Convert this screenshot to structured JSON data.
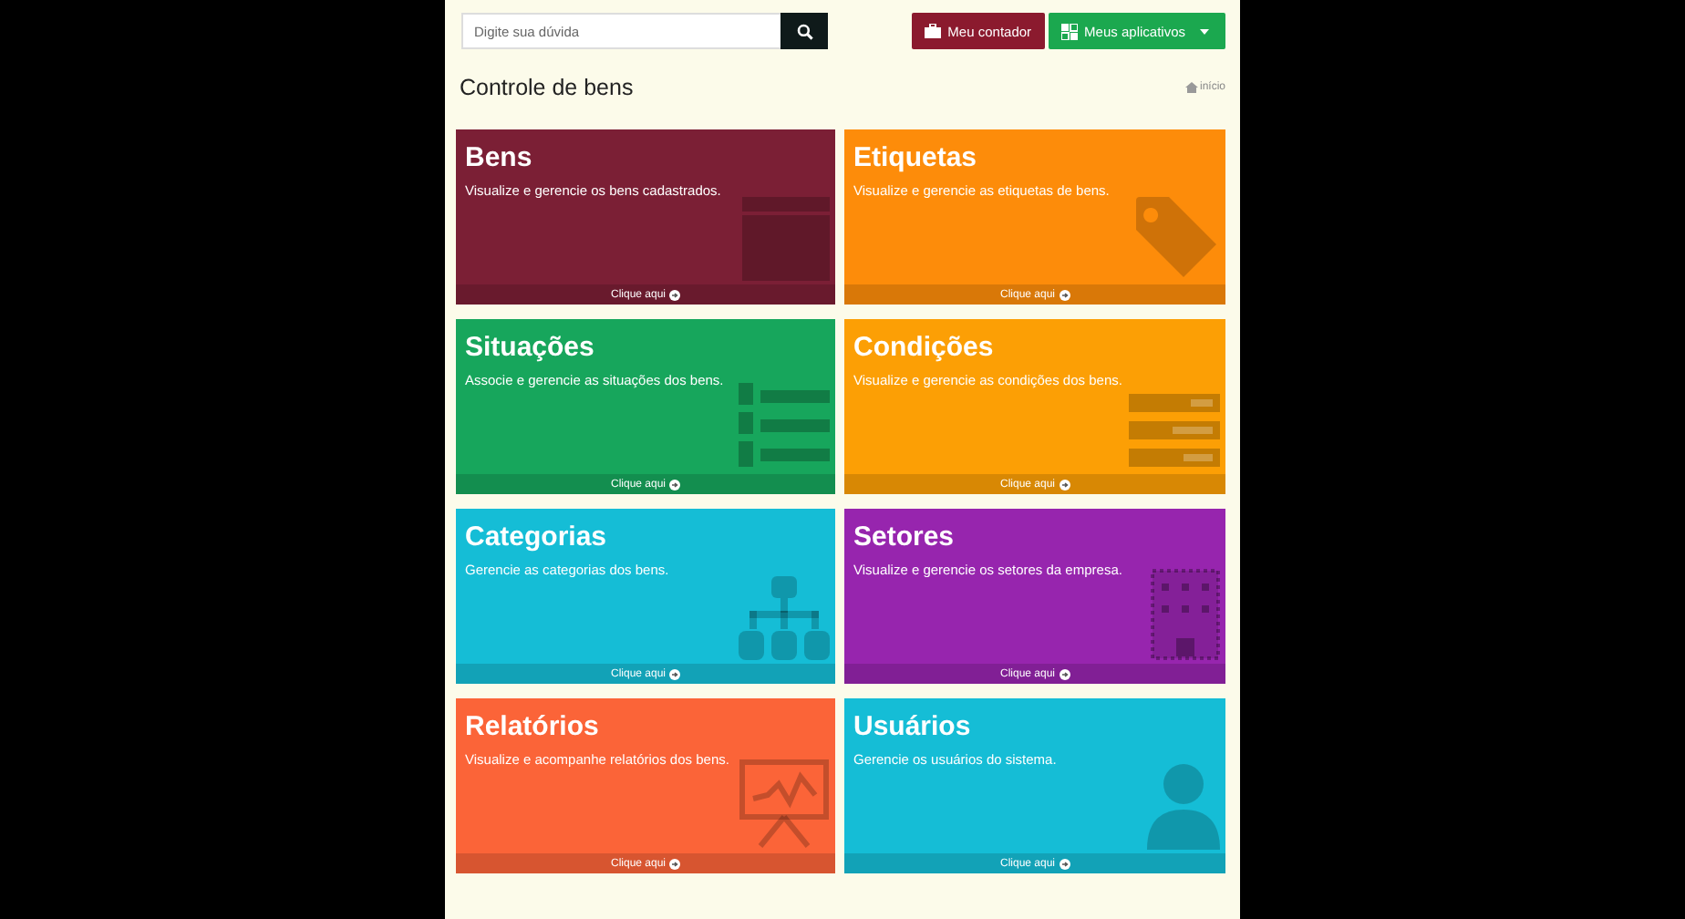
{
  "search": {
    "placeholder": "Digite sua dúvida"
  },
  "header_buttons": [
    {
      "label": "Meu contador",
      "color": "#8b1a2e",
      "kind": "briefcase"
    },
    {
      "label": "Meus aplicativos",
      "color": "#1ba84f",
      "kind": "apps"
    }
  ],
  "page_title": "Controle de bens",
  "breadcrumb": "início",
  "cards": [
    {
      "title": "Bens",
      "description": "Visualize e gerencie os bens cadastrados.",
      "link": "Clique aqui",
      "color": "#7b1f35"
    },
    {
      "title": "Etiquetas",
      "description": "Visualize e gerencie as etiquetas de bens.",
      "link": "Clique aqui",
      "color": "#fd8c0a"
    },
    {
      "title": "Situações",
      "description": "Associe e gerencie as situações dos bens.",
      "link": "Clique aqui",
      "color": "#17a65c"
    },
    {
      "title": "Condições",
      "description": "Visualize e gerencie as condições dos bens.",
      "link": "Clique aqui",
      "color": "#fc9f05"
    },
    {
      "title": "Categorias",
      "description": "Gerencie as categorias dos bens.",
      "link": "Clique aqui",
      "color": "#15bdd6"
    },
    {
      "title": "Setores",
      "description": "Visualize e gerencie os setores da empresa.",
      "link": "Clique aqui",
      "color": "#9725ae"
    },
    {
      "title": "Relatórios",
      "description": "Visualize e acompanhe relatórios dos bens.",
      "link": "Clique aqui",
      "color": "#fb6438"
    },
    {
      "title": "Usuários",
      "description": "Gerencie os usuários do sistema.",
      "link": "Clique aqui",
      "color": "#15bdd6"
    }
  ]
}
